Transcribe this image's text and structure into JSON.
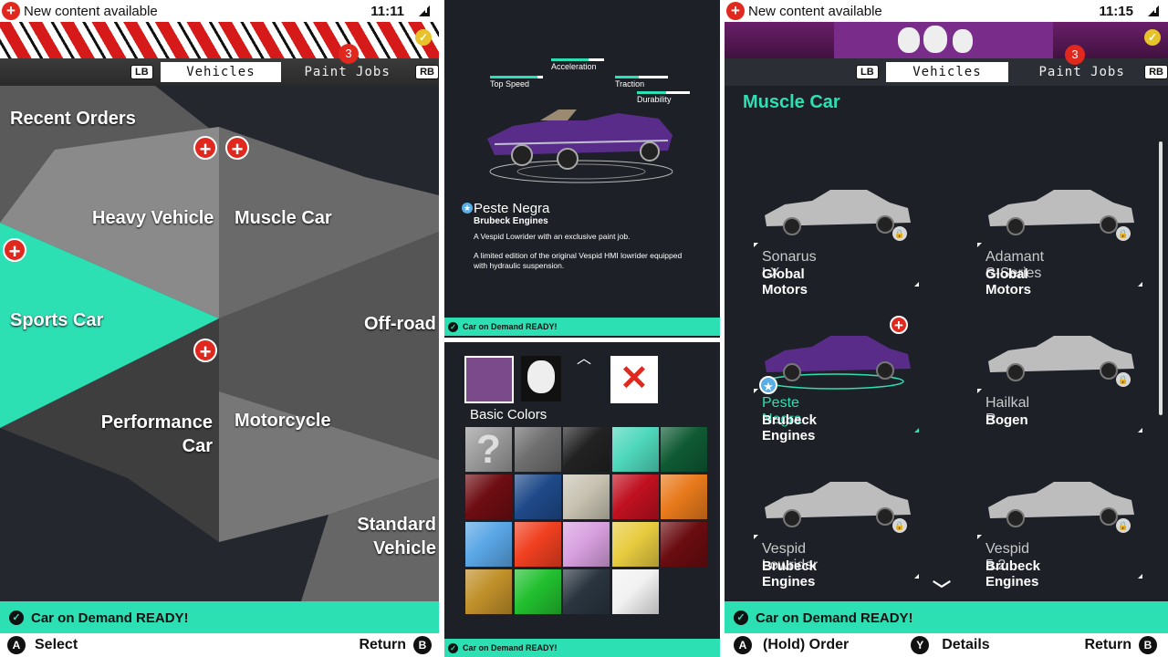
{
  "left": {
    "status": {
      "message": "New content available",
      "time": "11:11"
    },
    "tabs": {
      "lb": "LB",
      "active": "Vehicles",
      "inactive": "Paint Jobs",
      "rb": "RB",
      "badge": "3"
    },
    "menu": {
      "recent": "Recent Orders",
      "heavy": "Heavy Vehicle",
      "muscle": "Muscle Car",
      "sports": "Sports Car",
      "offroad": "Off-road",
      "performance": "Performance Car",
      "motorcycle": "Motorcycle",
      "standard": "Standard Vehicle"
    },
    "ready": "Car on Demand READY!",
    "bottom": {
      "a_btn": "A",
      "select": "Select",
      "return": "Return",
      "b_btn": "B"
    }
  },
  "mid": {
    "stats": [
      {
        "label": "Top Speed",
        "level": 0.9
      },
      {
        "label": "Acceleration",
        "level": 0.7
      },
      {
        "label": "Traction",
        "level": 0.45
      },
      {
        "label": "Durability",
        "level": 0.55
      }
    ],
    "car": {
      "name": "Peste Negra",
      "maker": "Brubeck Engines"
    },
    "desc1": "A Vespid Lowrider with an exclusive paint job.",
    "desc2": "A limited edition of the original Vespid HMI lowrider equipped with hydraulic suspension.",
    "ready": "Car on Demand READY!",
    "colors_title": "Basic Colors",
    "ready2": "Car on Demand READY!",
    "swatches": [
      "#9a9a9a",
      "#6e6e6e",
      "#222222",
      "#4fd8bc",
      "#0f5a34",
      "#6e0d12",
      "#1f4a8a",
      "#c8c3b2",
      "#c01020",
      "#e87a1c",
      "#5aa6e6",
      "#f04020",
      "#d8a0e0",
      "#e8cc40",
      "#6a0c10",
      "#c0902a",
      "#22c030",
      "#2a3540",
      "#f2f2f2"
    ]
  },
  "right": {
    "status": {
      "message": "New content available",
      "time": "11:15"
    },
    "tabs": {
      "lb": "LB",
      "active": "Vehicles",
      "inactive": "Paint Jobs",
      "rb": "RB",
      "badge": "3"
    },
    "category": "Muscle Car",
    "cars": [
      {
        "name": "Sonarus LX",
        "maker": "Global Motors",
        "locked": true
      },
      {
        "name": "Adamant S-Series",
        "maker": "Global Motors",
        "locked": true
      },
      {
        "name": "Peste Negra",
        "maker": "Brubeck Engines",
        "locked": false
      },
      {
        "name": "Hailkal R",
        "maker": "Bogen",
        "locked": true
      },
      {
        "name": "Vespid Lowrider",
        "maker": "Brubeck Engines",
        "locked": true
      },
      {
        "name": "Vespid 5.2",
        "maker": "Brubeck Engines",
        "locked": true
      }
    ],
    "ready": "Car on Demand READY!",
    "bottom": {
      "a_btn": "A",
      "order": "(Hold) Order",
      "y_btn": "Y",
      "details": "Details",
      "return": "Return",
      "b_btn": "B"
    }
  },
  "colors": {
    "accent": "#2de0b4",
    "alert": "#e0281e",
    "panel": "#1d2026"
  }
}
